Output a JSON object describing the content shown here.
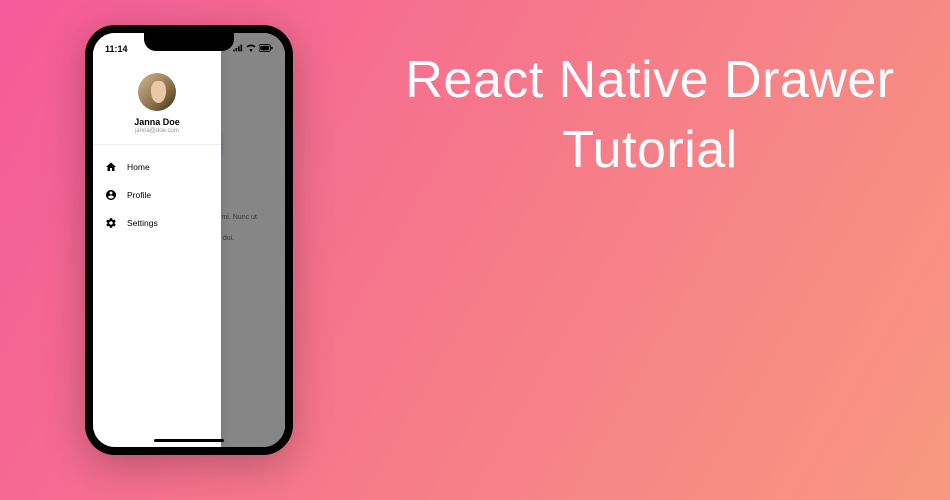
{
  "headline": "React Native Drawer Tutorial",
  "status": {
    "time": "11:14"
  },
  "drawer": {
    "user": {
      "name": "Janna Doe",
      "email": "janna@doe.com"
    },
    "items": [
      {
        "icon": "home",
        "label": "Home"
      },
      {
        "icon": "profile",
        "label": "Profile"
      },
      {
        "icon": "settings",
        "label": "Settings"
      }
    ]
  },
  "content": {
    "paragraphs": [
      "adipiscing elit. erra orci. Morbi s mi. Nunc ut",
      "cidunt, felis es a rhoncus dui."
    ]
  }
}
